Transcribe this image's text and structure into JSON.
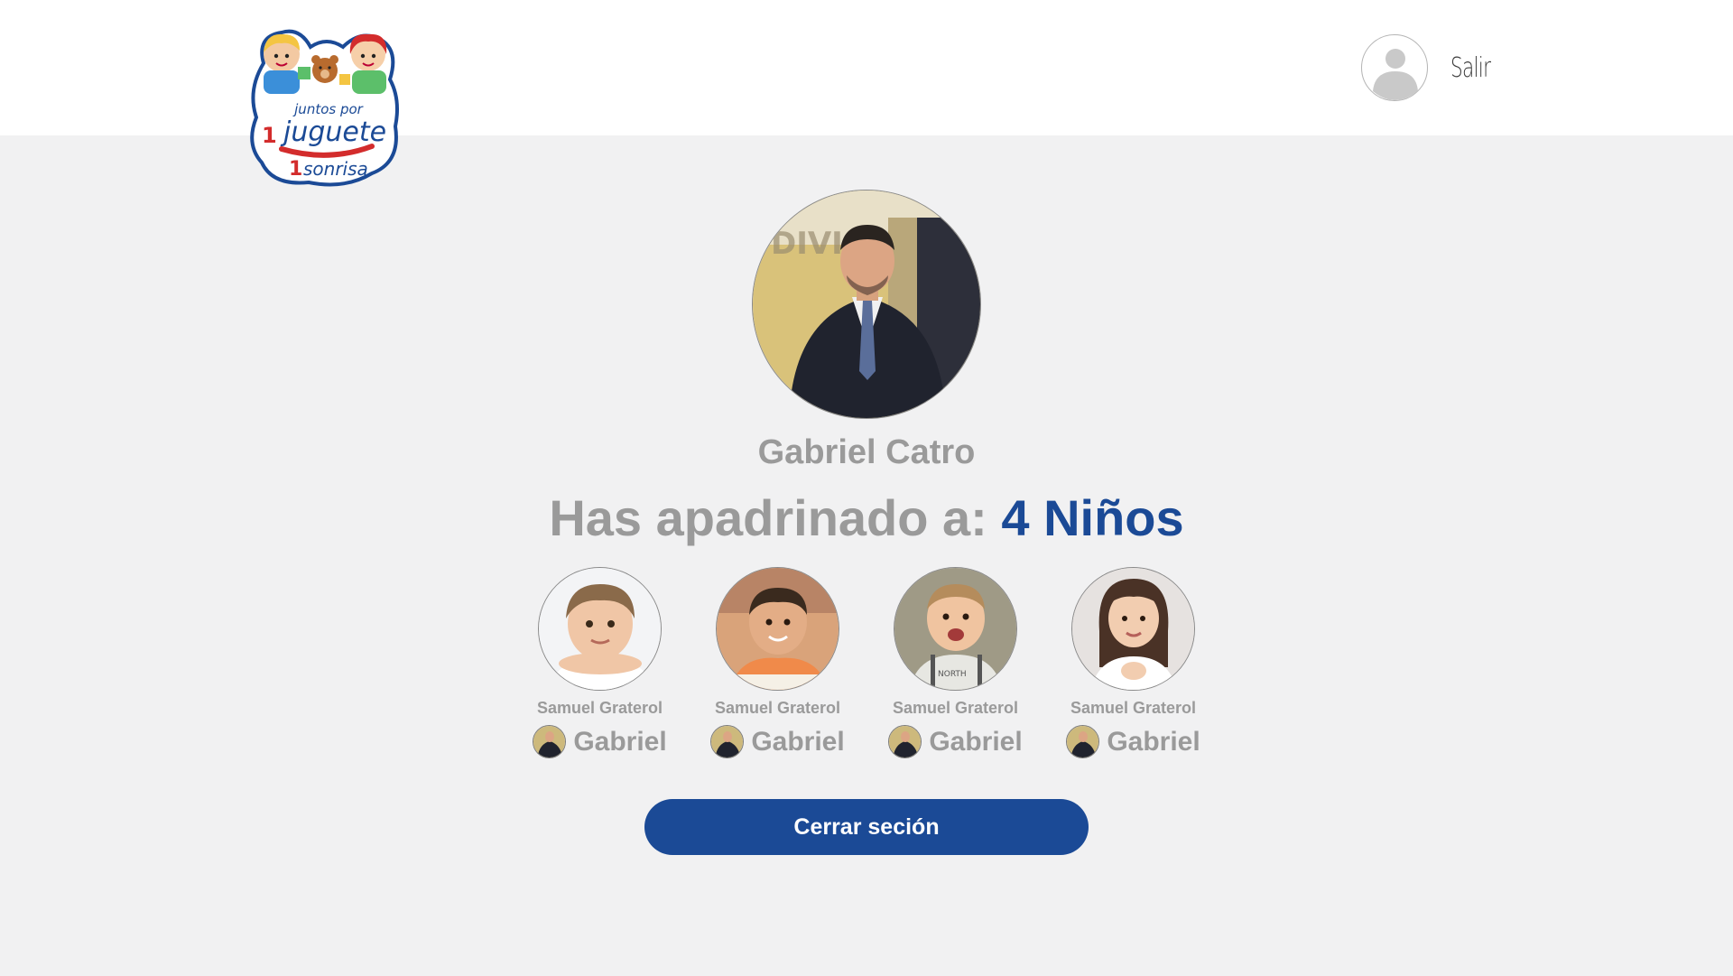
{
  "header": {
    "logo": {
      "text_line1": "juntos por",
      "text_num1": "1",
      "text_word1": "juguete",
      "text_num2": "1",
      "text_word2": "sonrisa"
    },
    "logout_label": "Salir",
    "avatar_icon": "user-placeholder-icon"
  },
  "profile": {
    "name": "Gabriel Catro",
    "sponsor_text": "Has apadrinado a:",
    "sponsor_count": "4 Niños"
  },
  "children": [
    {
      "name": "Samuel Graterol",
      "sponsor": "Gabriel"
    },
    {
      "name": "Samuel Graterol",
      "sponsor": "Gabriel"
    },
    {
      "name": "Samuel Graterol",
      "sponsor": "Gabriel"
    },
    {
      "name": "Samuel Graterol",
      "sponsor": "Gabriel"
    }
  ],
  "actions": {
    "close_session_label": "Cerrar seción"
  },
  "colors": {
    "brand_blue": "#1b4a96",
    "text_gray": "#9a9a9a",
    "page_bg": "#f1f1f2"
  }
}
